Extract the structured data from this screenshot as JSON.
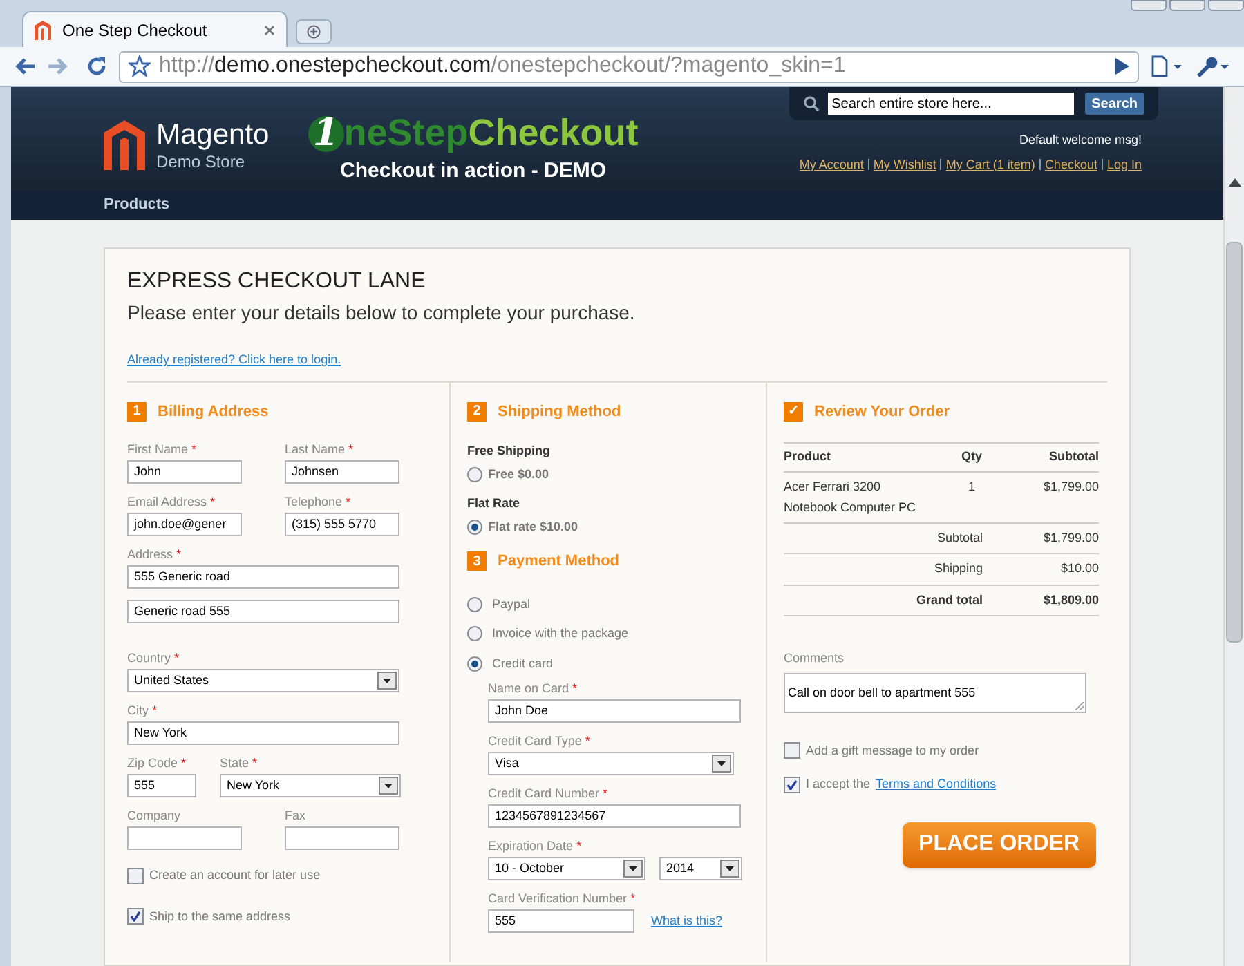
{
  "browser": {
    "tab_title": "One Step Checkout",
    "url": {
      "scheme": "http://",
      "host": "demo.onestepcheckout.com",
      "path": "/onestepcheckout/?magento_skin=1"
    }
  },
  "header": {
    "store_name": "Magento",
    "store_subtitle": "Demo Store",
    "logo_parts": [
      "1",
      "neStep",
      "Checkout"
    ],
    "tagline": "Checkout in action - DEMO",
    "search": {
      "placeholder": "Search entire store here...",
      "button": "Search"
    },
    "welcome": "Default welcome msg!",
    "links": [
      "My Account",
      "My Wishlist",
      "My Cart (1 item)",
      "Checkout",
      "Log In"
    ],
    "nav": [
      "Products"
    ]
  },
  "checkout": {
    "title": "EXPRESS CHECKOUT LANE",
    "subtitle": "Please enter your details below to complete your purchase.",
    "login_link": "Already registered? Click here to login.",
    "billing": {
      "number": "1",
      "title": "Billing Address",
      "rows": [
        {
          "fields": [
            {
              "label": "First Name",
              "mark": "*",
              "value": "John",
              "kind": "text"
            },
            {
              "label": "Last Name",
              "mark": "*",
              "value": "Johnsen",
              "kind": "text"
            }
          ]
        },
        {
          "fields": [
            {
              "label": "Email Address",
              "mark": "*",
              "value": "john.doe@gener",
              "kind": "text"
            },
            {
              "label": "Telephone",
              "mark": "*",
              "value": "(315) 555 5770",
              "kind": "text"
            }
          ]
        },
        {
          "fields": [
            {
              "label": "Address",
              "mark": "*",
              "value": "555 Generic road",
              "kind": "text"
            }
          ]
        },
        {
          "fields": [
            {
              "value": "Generic road 555",
              "kind": "text"
            }
          ]
        },
        {
          "fields": [
            {
              "label": "Country",
              "mark": "*",
              "value": "United States",
              "kind": "select"
            }
          ]
        },
        {
          "fields": [
            {
              "label": "City",
              "mark": "*",
              "value": "New York",
              "kind": "text"
            }
          ]
        },
        {
          "fields": [
            {
              "label": "Zip Code",
              "mark": "*",
              "value": "555",
              "kind": "text"
            },
            {
              "label": "State",
              "mark": "*",
              "value": "New York",
              "kind": "select"
            }
          ]
        },
        {
          "fields": [
            {
              "label": "Company",
              "kind": "text"
            },
            {
              "label": "Fax",
              "kind": "text"
            }
          ]
        }
      ],
      "options": [
        {
          "label": "Create an account for later use",
          "checked": false
        },
        {
          "label": "Ship to the same address",
          "checked": true
        }
      ]
    },
    "shipping": {
      "number": "2",
      "title": "Shipping Method",
      "groups": [
        {
          "title": "Free Shipping",
          "options": [
            {
              "label": "Free $0.00",
              "selected": false
            }
          ]
        },
        {
          "title": "Flat Rate",
          "options": [
            {
              "label": "Flat rate $10.00",
              "selected": true
            }
          ]
        }
      ]
    },
    "payment": {
      "number": "3",
      "title": "Payment Method",
      "methods": [
        {
          "label": "Paypal",
          "selected": false
        },
        {
          "label": "Invoice with the package",
          "selected": false
        },
        {
          "label": "Credit card",
          "selected": true
        }
      ],
      "card_fields": [
        {
          "label": "Name on Card",
          "mark": "*",
          "inputs": [
            {
              "value": "John Doe",
              "kind": "text"
            }
          ]
        },
        {
          "label": "Credit Card Type",
          "mark": "*",
          "inputs": [
            {
              "value": "Visa",
              "kind": "select"
            }
          ]
        },
        {
          "label": "Credit Card Number",
          "mark": "*",
          "inputs": [
            {
              "value": "1234567891234567",
              "kind": "text"
            }
          ]
        },
        {
          "label": "Expiration Date",
          "mark": "*",
          "inputs": [
            {
              "value": "10 - October",
              "kind": "select"
            },
            {
              "value": "2014",
              "kind": "select"
            }
          ]
        },
        {
          "label": "Card Verification Number",
          "mark": "*",
          "inputs": [
            {
              "value": "555",
              "kind": "text"
            }
          ],
          "link": "What is this?"
        }
      ]
    },
    "review": {
      "number": "✓",
      "title": "Review Your Order",
      "columns": [
        "Product",
        "Qty",
        "Subtotal"
      ],
      "rows": [
        {
          "product": "Acer Ferrari 3200 Notebook Computer PC",
          "qty": "1",
          "subtotal": "$1,799.00"
        }
      ],
      "totals": [
        {
          "label": "Subtotal",
          "value": "$1,799.00",
          "bold": false
        },
        {
          "label": "Shipping",
          "value": "$10.00",
          "bold": false
        },
        {
          "label": "Grand total",
          "value": "$1,809.00",
          "bold": true
        }
      ],
      "comments_label": "Comments",
      "comments": "Call on door bell to apartment 555",
      "options": [
        {
          "label": "Add a gift message to my order",
          "checked": false
        },
        {
          "label": "I accept the",
          "link": "Terms and Conditions",
          "checked": true
        }
      ],
      "button": "PLACE ORDER"
    }
  }
}
